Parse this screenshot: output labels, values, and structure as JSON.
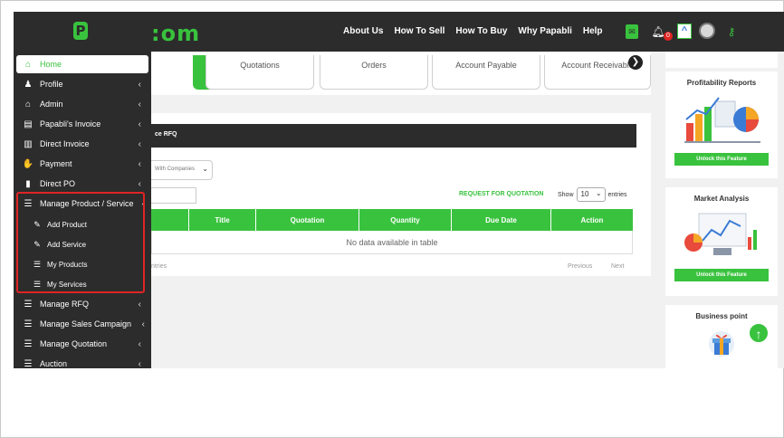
{
  "brand": {
    "logo_letter": "P",
    "domain_text": ":om"
  },
  "topnav": [
    "About Us",
    "How To Sell",
    "How To Buy",
    "Why Papabli",
    "Help"
  ],
  "topicons": {
    "mail": "mail-icon",
    "bell": "bell-icon",
    "badge": "0",
    "caret": "^",
    "key": "key-icon"
  },
  "tabs": [
    "",
    "Quotations",
    "Orders",
    "Account Payable",
    "Account Receivable"
  ],
  "rfq": {
    "header": "ce RFQ",
    "company_select": "With Companies",
    "request_link": "REQUEST FOR QUOTATION",
    "show_label": "Show",
    "show_value": "10",
    "entries_label": "entries",
    "columns": [
      "",
      "Title",
      "Quotation",
      "Quantity",
      "Due Date",
      "Action"
    ],
    "empty_text": "No data available in table",
    "footer_left": "ntries",
    "prev": "Previous",
    "next": "Next"
  },
  "right": {
    "profitability_title": "Profitability Reports",
    "market_title": "Market Analysis",
    "unlock_label": "Unlock this Feature",
    "business_title": "Business point"
  },
  "sidebar": {
    "items": [
      {
        "label": "Home",
        "icon": "home-icon"
      },
      {
        "label": "Profile",
        "icon": "user-icon"
      },
      {
        "label": "Admin",
        "icon": "admin-home-icon"
      },
      {
        "label": "Papabli's Invoice",
        "icon": "id-card-icon"
      },
      {
        "label": "Direct Invoice",
        "icon": "document-icon"
      },
      {
        "label": "Payment",
        "icon": "payment-icon"
      },
      {
        "label": "Direct PO",
        "icon": "file-icon"
      },
      {
        "label": "Manage Product / Service",
        "icon": "list-icon"
      },
      {
        "label": "Add Product",
        "icon": "edit-icon"
      },
      {
        "label": "Add Service",
        "icon": "edit-icon"
      },
      {
        "label": "My Products",
        "icon": "list-icon"
      },
      {
        "label": "My Services",
        "icon": "list-icon"
      },
      {
        "label": "Manage RFQ",
        "icon": "list-icon"
      },
      {
        "label": "Manage Sales Campaign",
        "icon": "list-icon"
      },
      {
        "label": "Manage Quotation",
        "icon": "list-icon"
      },
      {
        "label": "Auction",
        "icon": "list-icon"
      }
    ],
    "arrow": "‹"
  },
  "colors": {
    "accent": "#39c23e",
    "dark": "#2c2c2c",
    "highlight": "#e02424"
  }
}
